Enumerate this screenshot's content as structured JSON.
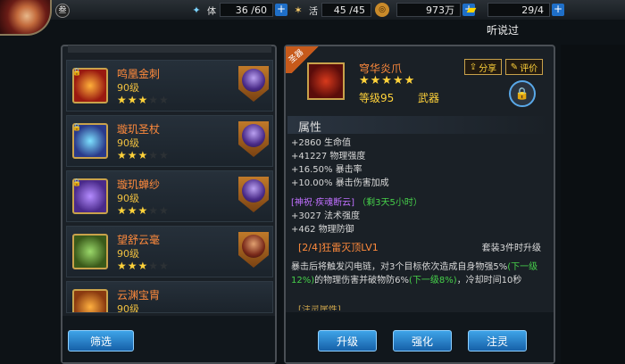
{
  "top": {
    "badge": "叁",
    "stamina": "36 /60",
    "vitality": "45 /45",
    "coins": "973万",
    "gold": "29/4",
    "notice": "听说过"
  },
  "list": {
    "items": [
      {
        "name": "鸣凰金刺",
        "level": "90级",
        "stars": 3
      },
      {
        "name": "璇玑圣杖",
        "level": "90级",
        "stars": 3
      },
      {
        "name": "璇玑蝉纱",
        "level": "90级",
        "stars": 3
      },
      {
        "name": "望舒云毫",
        "level": "90级",
        "stars": 3
      },
      {
        "name": "云渊宝胄",
        "level": "90级",
        "stars": 3
      }
    ],
    "filter_label": "筛选"
  },
  "detail": {
    "ribbon": "圣器",
    "name": "穹华炎爪",
    "stars": 5,
    "level": "等级95",
    "type": "武器",
    "share": "分享",
    "rate": "评价",
    "attr_title": "属性",
    "attrs": [
      "+2860 生命值",
      "+41227 物理强度",
      "+16.50% 暴击率",
      "+10.00% 暴击伤害加成"
    ],
    "blessing": "[神祝·疾魂断云]",
    "blessing_time": "（剩3天5小时）",
    "blessing_attrs": [
      "+3027 法术强度",
      "+462 物理防御"
    ],
    "skill_title": "[2/4]狂雷灭顶LV1",
    "skill_note": "套装3件时升级",
    "skill_desc_1": "暴击后将触发闪电链，对3个目标依次造成自身物强5%",
    "skill_next_1": "(下一级12%)",
    "skill_desc_2": "的物理伤害并破物防6%",
    "skill_next_2": "(下一级8%)",
    "skill_desc_3": "，冷却时间10秒",
    "cut_line": "[注灵属性]",
    "btn_upgrade": "升级",
    "btn_enhance": "强化",
    "btn_infuse": "注灵"
  }
}
